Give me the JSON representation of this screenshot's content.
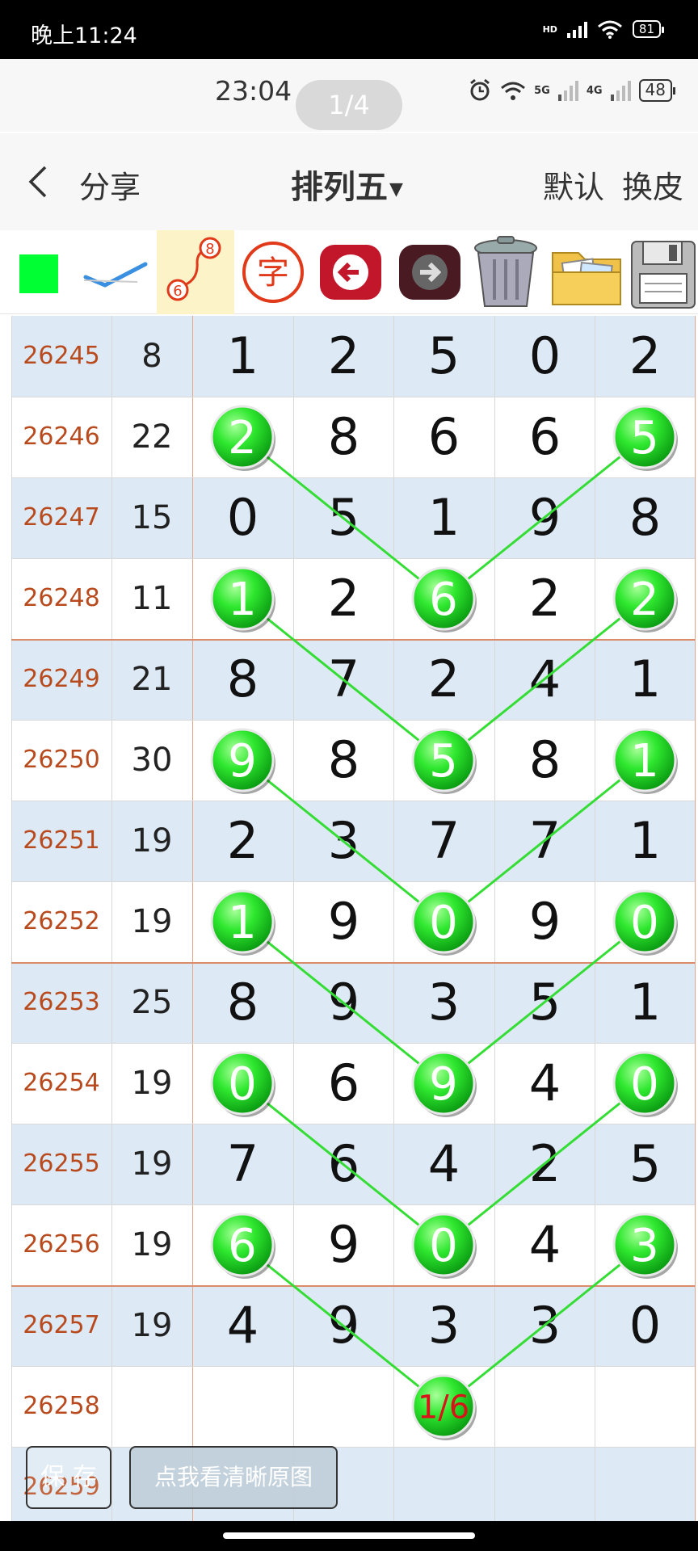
{
  "outer_status": {
    "time": "晚上11:24",
    "hd": "HD",
    "battery": "81"
  },
  "inner_status": {
    "time": "23:04",
    "page_indicator": "1/4",
    "battery": "48",
    "net1": "5G",
    "net2": "4G"
  },
  "nav": {
    "share": "分享",
    "title": "排列五",
    "default": "默认",
    "skin": "换皮"
  },
  "toolbar": {
    "char_icon": "字",
    "link_icon_top": "8",
    "link_icon_bottom": "6"
  },
  "table": {
    "rows": [
      {
        "issue": "26245",
        "sum": "8",
        "digits": [
          "1",
          "2",
          "5",
          "0",
          "2"
        ]
      },
      {
        "issue": "26246",
        "sum": "22",
        "digits": [
          "2",
          "8",
          "6",
          "6",
          "5"
        ]
      },
      {
        "issue": "26247",
        "sum": "15",
        "digits": [
          "0",
          "5",
          "1",
          "9",
          "8"
        ]
      },
      {
        "issue": "26248",
        "sum": "11",
        "digits": [
          "1",
          "2",
          "6",
          "2",
          "2"
        ]
      },
      {
        "issue": "26249",
        "sum": "21",
        "digits": [
          "8",
          "7",
          "2",
          "4",
          "1"
        ]
      },
      {
        "issue": "26250",
        "sum": "30",
        "digits": [
          "9",
          "8",
          "5",
          "8",
          "1"
        ]
      },
      {
        "issue": "26251",
        "sum": "19",
        "digits": [
          "2",
          "3",
          "7",
          "7",
          "1"
        ]
      },
      {
        "issue": "26252",
        "sum": "19",
        "digits": [
          "1",
          "9",
          "0",
          "9",
          "0"
        ]
      },
      {
        "issue": "26253",
        "sum": "25",
        "digits": [
          "8",
          "9",
          "3",
          "5",
          "1"
        ]
      },
      {
        "issue": "26254",
        "sum": "19",
        "digits": [
          "0",
          "6",
          "9",
          "4",
          "0"
        ]
      },
      {
        "issue": "26255",
        "sum": "19",
        "digits": [
          "7",
          "6",
          "4",
          "2",
          "5"
        ]
      },
      {
        "issue": "26256",
        "sum": "19",
        "digits": [
          "6",
          "9",
          "0",
          "4",
          "3"
        ]
      },
      {
        "issue": "26257",
        "sum": "19",
        "digits": [
          "4",
          "9",
          "3",
          "3",
          "0"
        ]
      },
      {
        "issue": "26258",
        "sum": "",
        "digits": [
          "",
          "",
          "",
          "",
          ""
        ]
      },
      {
        "issue": "26259",
        "sum": "",
        "digits": [
          "",
          "",
          "",
          "",
          ""
        ]
      }
    ],
    "highlights": [
      [
        1,
        0
      ],
      [
        1,
        4
      ],
      [
        3,
        2
      ],
      [
        3,
        0
      ],
      [
        3,
        4
      ],
      [
        5,
        2
      ],
      [
        5,
        0
      ],
      [
        5,
        4
      ],
      [
        7,
        2
      ],
      [
        7,
        0
      ],
      [
        7,
        4
      ],
      [
        9,
        2
      ],
      [
        9,
        0
      ],
      [
        9,
        4
      ],
      [
        11,
        2
      ],
      [
        11,
        0
      ],
      [
        11,
        4
      ]
    ],
    "prediction": {
      "row": 13,
      "col": 2,
      "text": "1/6"
    },
    "colors": {
      "highlight": "#22dd22",
      "line": "#33dd33",
      "issue_text": "#b84a1d",
      "row_alt": "#dde9f4"
    }
  },
  "bottom": {
    "save": "保 存",
    "view_original": "点我看清晰原图"
  }
}
